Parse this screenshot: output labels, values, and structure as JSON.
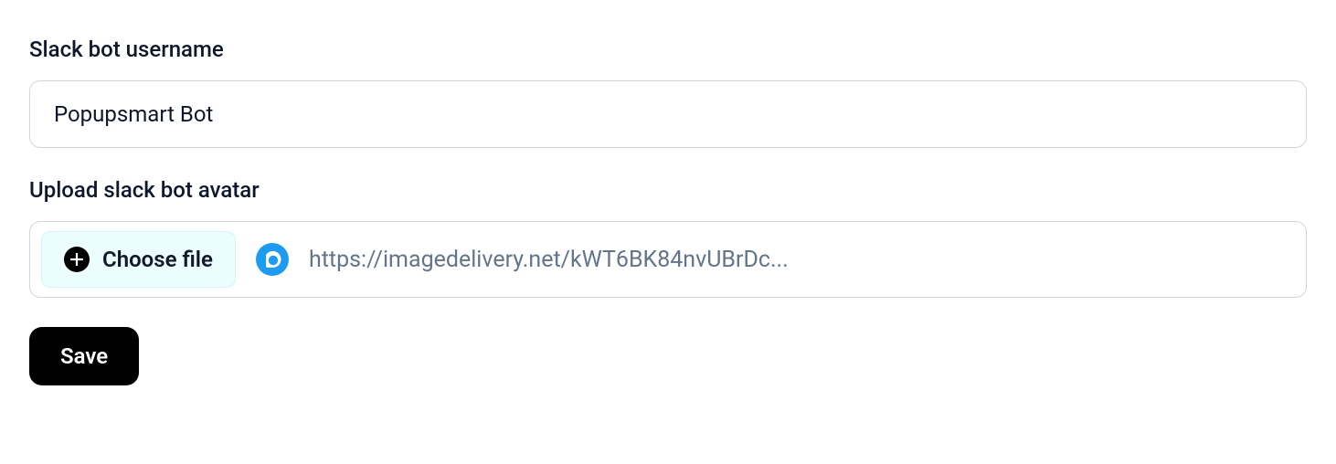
{
  "form": {
    "username_label": "Slack bot username",
    "username_value": "Popupsmart Bot",
    "avatar_label": "Upload slack bot avatar",
    "choose_file_label": "Choose file",
    "file_url": "https://imagedelivery.net/kWT6BK84nvUBrDc...",
    "save_label": "Save"
  }
}
